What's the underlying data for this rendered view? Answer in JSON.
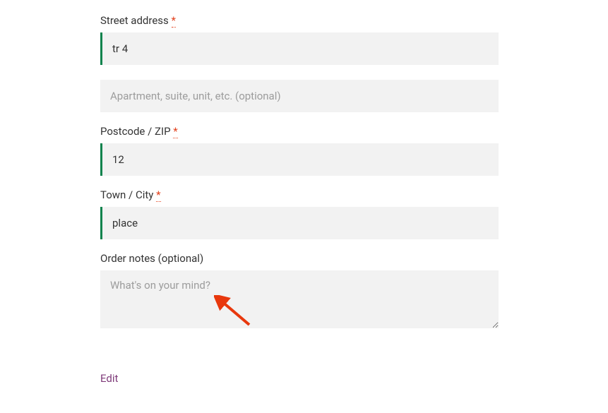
{
  "fields": {
    "street": {
      "label": "Street address",
      "required": "*",
      "value": "tr 4"
    },
    "apt": {
      "placeholder": "Apartment, suite, unit, etc. (optional)",
      "value": ""
    },
    "zip": {
      "label": "Postcode / ZIP",
      "required": "*",
      "value": "12"
    },
    "city": {
      "label": "Town / City",
      "required": "*",
      "value": "place"
    },
    "notes": {
      "label": "Order notes (optional)",
      "placeholder": "What's on your mind?",
      "value": ""
    }
  },
  "edit_link": "Edit"
}
